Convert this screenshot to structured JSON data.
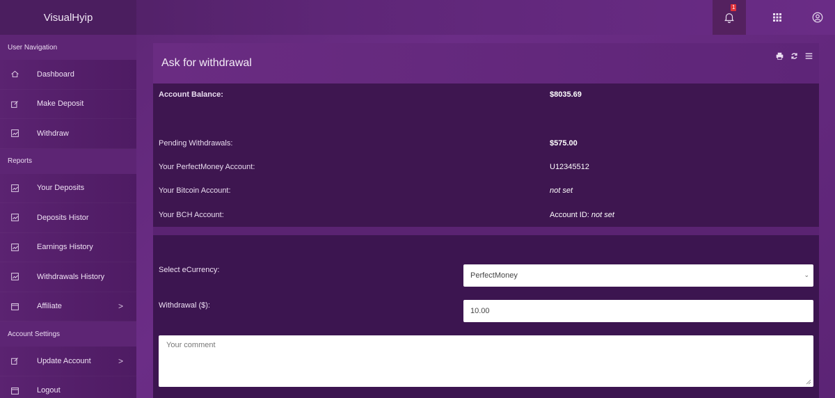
{
  "app": {
    "brand": "VisualHyip"
  },
  "topbar": {
    "notification_count": "1",
    "icons": [
      "bell-icon",
      "grid-icon",
      "user-circle-icon"
    ]
  },
  "sidebar": {
    "sections": [
      {
        "title": "User Navigation",
        "items": [
          {
            "label": "Dashboard",
            "icon": "home-icon"
          },
          {
            "label": "Make Deposit",
            "icon": "edit-icon"
          },
          {
            "label": "Withdraw",
            "icon": "chart-icon"
          }
        ]
      },
      {
        "title": "Reports",
        "items": [
          {
            "label": "Your Deposits",
            "icon": "chart-icon"
          },
          {
            "label": "Deposits Histor",
            "icon": "chart-icon"
          },
          {
            "label": "Earnings History",
            "icon": "chart-icon"
          },
          {
            "label": "Withdrawals History",
            "icon": "chart-icon"
          },
          {
            "label": "Affiliate",
            "icon": "window-icon",
            "chevron": ">"
          }
        ]
      },
      {
        "title": "Account Settings",
        "items": [
          {
            "label": "Update Account",
            "icon": "edit-icon",
            "chevron": ">"
          },
          {
            "label": "Logout",
            "icon": "window-icon"
          }
        ]
      }
    ]
  },
  "panel": {
    "title": "Ask for withdrawal",
    "tools": [
      "print-icon",
      "refresh-icon",
      "menu-icon"
    ],
    "info": {
      "balance_label": "Account Balance:",
      "balance_value": "$8035.69",
      "pending_label": "Pending Withdrawals:",
      "pending_value": "$575.00",
      "pm_label": "Your PerfectMoney Account:",
      "pm_value": "U12345512",
      "btc_label": "Your Bitcoin Account:",
      "btc_value": "not set",
      "bch_label": "Your BCH Account:",
      "bch_prefix": "Account ID: ",
      "bch_value": "not set"
    },
    "form": {
      "currency_label": "Select eCurrency:",
      "currency_selected": "PerfectMoney",
      "amount_label": "Withdrawal ($):",
      "amount_value": "10.00",
      "comment_placeholder": "Your comment"
    }
  },
  "colors": {
    "background": "#5a2470",
    "panel_dark": "#3e1650",
    "sidebar": "#561f6c",
    "badge": "#e0323a"
  }
}
